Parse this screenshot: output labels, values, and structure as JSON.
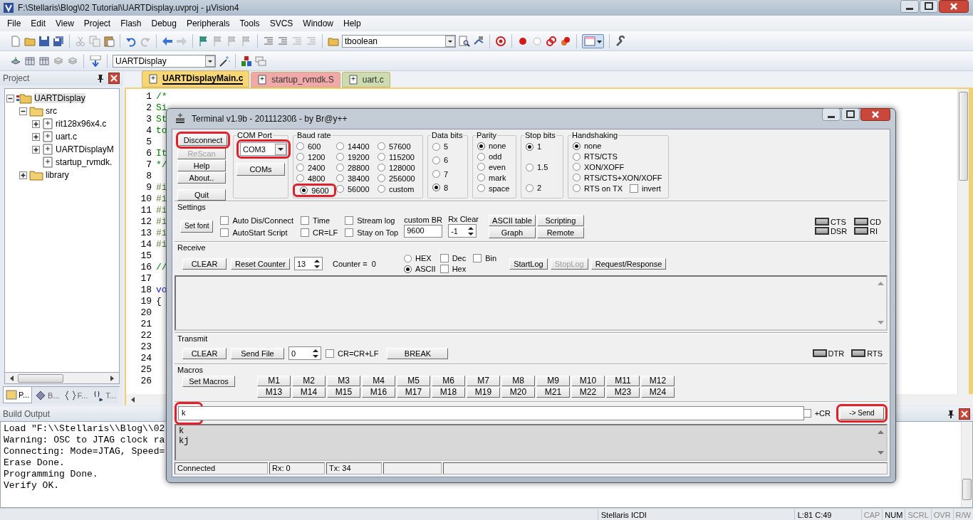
{
  "window": {
    "title": "F:\\Stellaris\\Blog\\02 Tutorial\\UARTDisplay.uvproj - µVision4"
  },
  "menu": [
    "File",
    "Edit",
    "View",
    "Project",
    "Flash",
    "Debug",
    "Peripherals",
    "Tools",
    "SVCS",
    "Window",
    "Help"
  ],
  "toolbar": {
    "target_combo": "tboolean"
  },
  "toolbar2": {
    "project_combo": "UARTDisplay"
  },
  "project_pane": {
    "title": "Project",
    "tree": [
      {
        "label": "UARTDisplay",
        "kind": "project",
        "expandable": true,
        "expanded": true,
        "selected": true,
        "children": [
          {
            "label": "src",
            "kind": "folder",
            "expandable": true,
            "expanded": true,
            "selected": false,
            "children": [
              {
                "label": "rit128x96x4.c",
                "kind": "file",
                "expandable": true,
                "expanded": false,
                "selected": false
              },
              {
                "label": "uart.c",
                "kind": "file",
                "expandable": true,
                "expanded": false,
                "selected": false
              },
              {
                "label": "UARTDisplayM",
                "kind": "file",
                "expandable": true,
                "expanded": false,
                "selected": false
              },
              {
                "label": "startup_rvmdk.",
                "kind": "file",
                "expandable": false,
                "selected": false
              }
            ]
          },
          {
            "label": "library",
            "kind": "folder",
            "expandable": true,
            "expanded": false,
            "selected": false
          }
        ]
      }
    ],
    "tabs": [
      {
        "label": "P...",
        "selected": true
      },
      {
        "label": "B...",
        "selected": false
      },
      {
        "label": "F...",
        "selected": false
      },
      {
        "label": "T...",
        "selected": false
      }
    ]
  },
  "editor": {
    "tabs": [
      {
        "label": "UARTDisplayMain.c",
        "selected": true,
        "color": "#f7d676"
      },
      {
        "label": "startup_rvmdk.S",
        "selected": false,
        "color": "#f0a8a8"
      },
      {
        "label": "uart.c",
        "selected": false,
        "color": "#cddbb0"
      }
    ],
    "lines": [
      {
        "number": "1",
        "text": "/*",
        "kind": "comment"
      },
      {
        "number": "2",
        "text": "Si",
        "kind": "comment"
      },
      {
        "number": "3",
        "text": "St",
        "kind": "comment"
      },
      {
        "number": "4",
        "text": "to",
        "kind": "comment"
      },
      {
        "number": "5"
      },
      {
        "number": "6",
        "text": "It",
        "kind": "comment"
      },
      {
        "number": "7",
        "text": "*/",
        "kind": "comment"
      },
      {
        "number": "8"
      },
      {
        "number": "9",
        "text": "#i",
        "kind": "preprocessor"
      },
      {
        "number": "10",
        "text": "#i",
        "kind": "preprocessor"
      },
      {
        "number": "11",
        "text": "#i",
        "kind": "preprocessor"
      },
      {
        "number": "12",
        "text": "#i",
        "kind": "preprocessor"
      },
      {
        "number": "13",
        "text": "#i",
        "kind": "preprocessor"
      },
      {
        "number": "14",
        "text": "#i",
        "kind": "preprocessor"
      },
      {
        "number": "15"
      },
      {
        "number": "16",
        "text": "//",
        "kind": "comment"
      },
      {
        "number": "17"
      },
      {
        "number": "18",
        "text": "vo",
        "kind": "keyword"
      },
      {
        "number": "19",
        "text": "{",
        "kind": "plain"
      },
      {
        "number": "20"
      },
      {
        "number": "21"
      },
      {
        "number": "22"
      },
      {
        "number": "23"
      },
      {
        "number": "24"
      },
      {
        "number": "25"
      },
      {
        "number": "26"
      }
    ]
  },
  "build_output": {
    "title": "Build Output",
    "lines": [
      "Load \"F:\\\\Stellaris\\\\Blog\\\\02",
      "Warning: OSC to JTAG clock ra",
      "Connecting: Mode=JTAG, Speed=",
      "Erase Done.",
      "Programming Done.",
      "Verify OK."
    ]
  },
  "status_bar": {
    "target": "Stellaris ICDI",
    "position": "L:81 C:49",
    "indicators": [
      {
        "label": "CAP",
        "on": false
      },
      {
        "label": "NUM",
        "on": true
      },
      {
        "label": "SCRL",
        "on": false
      },
      {
        "label": "OVR",
        "on": false
      },
      {
        "label": "R/W",
        "on": false
      }
    ]
  },
  "terminal": {
    "title": "Terminal v1.9b - 20111230ß - by Br@y++",
    "side_buttons": [
      {
        "label": "Disconnect",
        "disabled": false,
        "highlighted": true
      },
      {
        "label": "ReScan",
        "disabled": true,
        "highlighted": false
      },
      {
        "label": "Help",
        "disabled": false,
        "highlighted": false
      },
      {
        "label": "About..",
        "disabled": false,
        "highlighted": false
      },
      {
        "label": "Quit",
        "disabled": false,
        "highlighted": false
      }
    ],
    "com_port": {
      "label": "COM Port",
      "value": "COM3",
      "highlighted": true,
      "button": "COMs"
    },
    "baud_rate": {
      "label": "Baud rate",
      "options": [
        {
          "label": "600",
          "selected": false,
          "highlighted": false
        },
        {
          "label": "1200",
          "selected": false,
          "highlighted": false
        },
        {
          "label": "2400",
          "selected": false,
          "highlighted": false
        },
        {
          "label": "4800",
          "selected": false,
          "highlighted": false
        },
        {
          "label": "9600",
          "selected": true,
          "highlighted": true
        },
        {
          "label": "14400",
          "selected": false,
          "highlighted": false
        },
        {
          "label": "19200",
          "selected": false,
          "highlighted": false
        },
        {
          "label": "28800",
          "selected": false,
          "highlighted": false
        },
        {
          "label": "38400",
          "selected": false,
          "highlighted": false
        },
        {
          "label": "56000",
          "selected": false,
          "highlighted": false
        },
        {
          "label": "57600",
          "selected": false,
          "highlighted": false
        },
        {
          "label": "115200",
          "selected": false,
          "highlighted": false
        },
        {
          "label": "128000",
          "selected": false,
          "highlighted": false
        },
        {
          "label": "256000",
          "selected": false,
          "highlighted": false
        },
        {
          "label": "custom",
          "selected": false,
          "highlighted": false
        }
      ]
    },
    "data_bits": {
      "label": "Data bits",
      "options": [
        {
          "label": "5",
          "selected": false
        },
        {
          "label": "6",
          "selected": false
        },
        {
          "label": "7",
          "selected": false
        },
        {
          "label": "8",
          "selected": true
        }
      ]
    },
    "parity": {
      "label": "Parity",
      "options": [
        {
          "label": "none",
          "selected": true
        },
        {
          "label": "odd",
          "selected": false
        },
        {
          "label": "even",
          "selected": false
        },
        {
          "label": "mark",
          "selected": false
        },
        {
          "label": "space",
          "selected": false
        }
      ]
    },
    "stop_bits": {
      "label": "Stop bits",
      "options": [
        {
          "label": "1",
          "selected": true
        },
        {
          "label": "1.5",
          "selected": false
        },
        {
          "label": "2",
          "selected": false
        }
      ]
    },
    "handshaking": {
      "label": "Handshaking",
      "options": [
        {
          "label": "none",
          "selected": true
        },
        {
          "label": "RTS/CTS",
          "selected": false
        },
        {
          "label": "XON/XOFF",
          "selected": false
        },
        {
          "label": "RTS/CTS+XON/XOFF",
          "selected": false
        },
        {
          "label": "RTS on TX",
          "selected": false
        }
      ],
      "invert": {
        "label": "invert",
        "checked": false
      }
    },
    "settings": {
      "label": "Settings",
      "font_button": "Set font",
      "checkboxes": [
        {
          "label": "Auto Dis/Connect",
          "checked": false
        },
        {
          "label": "AutoStart Script",
          "checked": false
        },
        {
          "label": "Time",
          "checked": false
        },
        {
          "label": "CR=LF",
          "checked": false
        },
        {
          "label": "Stream log",
          "checked": false
        },
        {
          "label": "Stay on Top",
          "checked": false
        }
      ],
      "custom_br": {
        "label": "custom BR",
        "value": "9600"
      },
      "rx_clear": {
        "label": "Rx Clear",
        "value": "-1"
      },
      "buttons": [
        "ASCII table",
        "Scripting",
        "Graph",
        "Remote"
      ],
      "leds": [
        {
          "label": "CTS",
          "on": false
        },
        {
          "label": "CD",
          "on": false
        },
        {
          "label": "DSR",
          "on": false
        },
        {
          "label": "RI",
          "on": false
        }
      ]
    },
    "receive": {
      "label": "Receive",
      "clear_button": "CLEAR",
      "reset_button": "Reset Counter",
      "counter_spin": "13",
      "counter": "Counter =  0",
      "modes": [
        {
          "label": "HEX",
          "selected": false
        },
        {
          "label": "ASCII",
          "selected": true
        }
      ],
      "checkboxes": [
        {
          "label": "Dec",
          "checked": false
        },
        {
          "label": "Hex",
          "checked": false
        },
        {
          "label": "Bin",
          "checked": false
        }
      ],
      "buttons": [
        {
          "label": "StartLog",
          "disabled": false
        },
        {
          "label": "StopLog",
          "disabled": true
        },
        {
          "label": "Request/Response",
          "disabled": false
        }
      ]
    },
    "transmit": {
      "label": "Transmit",
      "clear_button": "CLEAR",
      "send_file_button": "Send File",
      "spin": "0",
      "cr_crlf": {
        "label": "CR=CR+LF",
        "checked": false
      },
      "break_button": "BREAK",
      "leds": [
        {
          "label": "DTR",
          "on": false
        },
        {
          "label": "RTS",
          "on": false
        }
      ]
    },
    "macros": {
      "label": "Macros",
      "set_button": "Set Macros",
      "buttons": [
        "M1",
        "M2",
        "M3",
        "M4",
        "M5",
        "M6",
        "M7",
        "M8",
        "M9",
        "M10",
        "M11",
        "M12",
        "M13",
        "M14",
        "M15",
        "M16",
        "M17",
        "M18",
        "M19",
        "M20",
        "M21",
        "M22",
        "M23",
        "M24"
      ]
    },
    "input": {
      "value": "k",
      "highlighted": true
    },
    "plus_cr": {
      "label": "+CR",
      "checked": false
    },
    "send_button": {
      "label": "-> Send",
      "highlighted": true
    },
    "output_lines": [
      "k",
      "kj"
    ],
    "status": [
      "Connected",
      "Rx: 0",
      "Tx: 34"
    ]
  }
}
